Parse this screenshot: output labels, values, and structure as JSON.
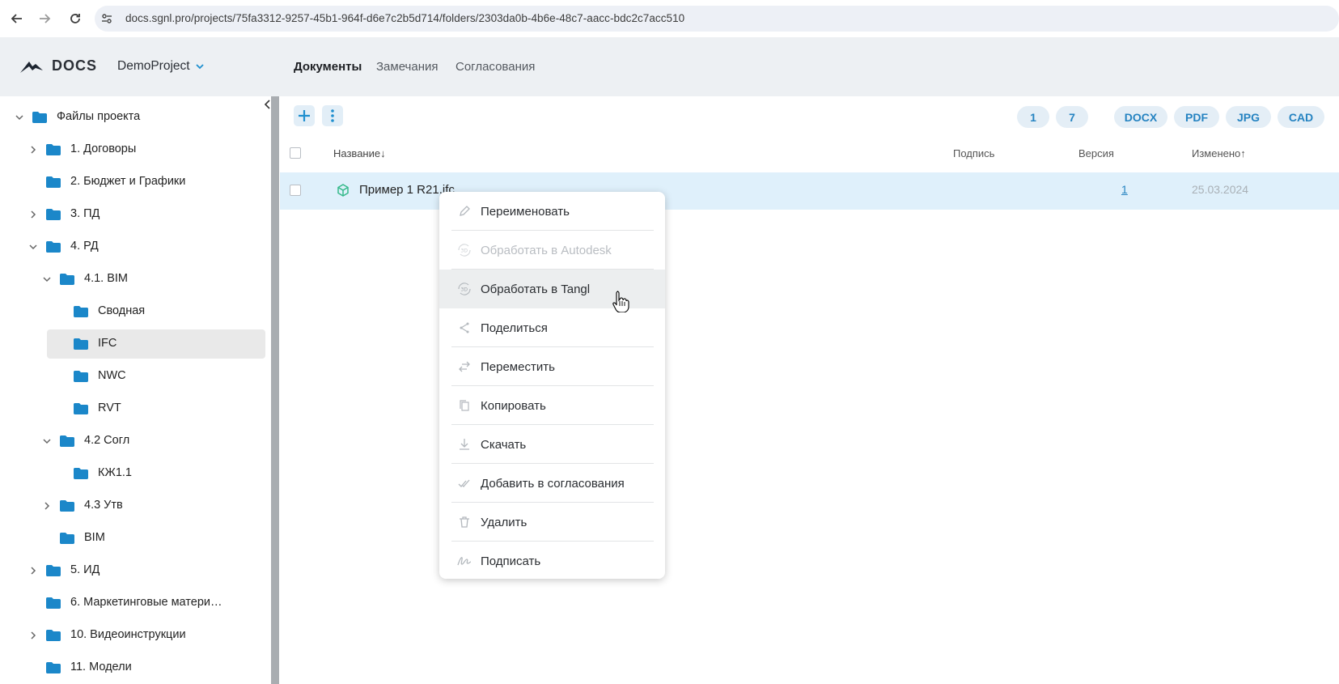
{
  "browser": {
    "url": "docs.sgnl.pro/projects/75fa3312-9257-45b1-964f-d6e7c2b5d714/folders/2303da0b-4b6e-48c7-aacc-bdc2c7acc510"
  },
  "header": {
    "logo_text": "DOCS",
    "project": "DemoProject",
    "tabs": [
      {
        "label": "Документы",
        "active": true
      },
      {
        "label": "Замечания",
        "active": false
      },
      {
        "label": "Согласования",
        "active": false
      }
    ]
  },
  "sidebar": {
    "items": [
      {
        "label": "Файлы проекта",
        "chevron": "down"
      },
      {
        "label": "1. Договоры",
        "chevron": "right"
      },
      {
        "label": "2. Бюджет и Графики",
        "chevron": "none"
      },
      {
        "label": "3. ПД",
        "chevron": "right"
      },
      {
        "label": "4. РД",
        "chevron": "down"
      },
      {
        "label": "4.1. BIM",
        "chevron": "down"
      },
      {
        "label": "Сводная",
        "chevron": "none"
      },
      {
        "label": "IFC",
        "chevron": "none",
        "selected": true
      },
      {
        "label": "NWC",
        "chevron": "none"
      },
      {
        "label": "RVT",
        "chevron": "none"
      },
      {
        "label": "4.2 Согл",
        "chevron": "down"
      },
      {
        "label": "КЖ1.1",
        "chevron": "none"
      },
      {
        "label": "4.3 Утв",
        "chevron": "right"
      },
      {
        "label": "BIM",
        "chevron": "none"
      },
      {
        "label": "5. ИД",
        "chevron": "right"
      },
      {
        "label": "6. Маркетинговые матери…",
        "chevron": "none"
      },
      {
        "label": "10. Видеоинструкции",
        "chevron": "right"
      },
      {
        "label": "11. Модели",
        "chevron": "none"
      }
    ]
  },
  "toolbar": {
    "add_label": "+",
    "pills": [
      "1",
      "7",
      "DOCX",
      "PDF",
      "JPG",
      "CAD"
    ]
  },
  "table": {
    "columns": {
      "name": "Название↓",
      "signature": "Подпись",
      "version": "Версия",
      "modified": "Изменено↑"
    },
    "rows": [
      {
        "name": "Пример 1 R21.ifc",
        "version": "1",
        "modified": "25.03.2024"
      }
    ]
  },
  "context_menu": {
    "items": [
      {
        "label": "Переименовать",
        "icon": "pencil-icon",
        "disabled": false
      },
      {
        "label": "Обработать в Autodesk",
        "icon": "3d-rotate-icon",
        "disabled": true
      },
      {
        "label": "Обработать в Tangl",
        "icon": "3d-rotate-icon",
        "disabled": false,
        "hover": true
      },
      {
        "label": "Поделиться",
        "icon": "share-icon",
        "disabled": false
      },
      {
        "label": "Переместить",
        "icon": "move-arrows-icon",
        "disabled": false
      },
      {
        "label": "Копировать",
        "icon": "copy-icon",
        "disabled": false
      },
      {
        "label": "Скачать",
        "icon": "download-icon",
        "disabled": false
      },
      {
        "label": "Добавить в согласования",
        "icon": "double-check-icon",
        "disabled": false
      },
      {
        "label": "Удалить",
        "icon": "trash-icon",
        "disabled": false
      },
      {
        "label": "Подписать",
        "icon": "signature-icon",
        "disabled": false
      }
    ]
  },
  "colors": {
    "accent": "#1f8fcf",
    "folder": "#1b87c9",
    "header_bg": "#edf0f3",
    "row_selected_bg": "#dff0fb"
  }
}
